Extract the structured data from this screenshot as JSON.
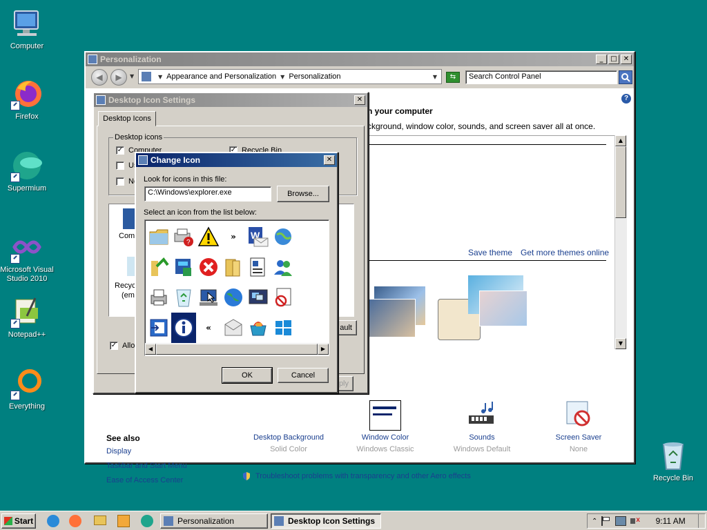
{
  "desktop": {
    "icons": [
      {
        "label": "Computer",
        "icon": "computer-icon"
      },
      {
        "label": "Firefox",
        "icon": "firefox-icon"
      },
      {
        "label": "Supermium",
        "icon": "supermium-icon"
      },
      {
        "label": "Microsoft Visual Studio 2010",
        "icon": "visual-studio-icon"
      },
      {
        "label": "Notepad++",
        "icon": "notepad-plus-plus-icon"
      },
      {
        "label": "Everything",
        "icon": "everything-icon"
      },
      {
        "label": "Recycle Bin",
        "icon": "recycle-bin-icon"
      }
    ]
  },
  "personalization": {
    "title": "Personalization",
    "breadcrumb": [
      "Appearance and Personalization",
      "Personalization"
    ],
    "search_placeholder": "Search Control Panel",
    "heading_partial": "n your computer",
    "subtitle_partial": "ckground, window color, sounds, and screen saver all at once.",
    "save_theme": "Save theme",
    "get_more_themes": "Get more themes online",
    "see_also": {
      "title": "See also",
      "links": [
        "Display",
        "Taskbar and Start Menu",
        "Ease of Access Center"
      ]
    },
    "settings": [
      {
        "label": "Desktop Background",
        "value": "Solid Color",
        "icon": "desktop-background-icon"
      },
      {
        "label": "Window Color",
        "value": "Windows Classic",
        "icon": "window-color-icon"
      },
      {
        "label": "Sounds",
        "value": "Windows Default",
        "icon": "sounds-icon"
      },
      {
        "label": "Screen Saver",
        "value": "None",
        "icon": "screen-saver-icon"
      }
    ],
    "troubleshoot": "Troubleshoot problems with transparency and other Aero effects"
  },
  "desktop_icon_settings": {
    "title": "Desktop Icon Settings",
    "tab": "Desktop Icons",
    "group_title": "Desktop icons",
    "checkboxes": [
      {
        "label": "Computer",
        "checked": true
      },
      {
        "label": "Us",
        "checked": false
      },
      {
        "label": "Ne",
        "checked": false
      },
      {
        "label": "Recycle Bin",
        "checked": true
      }
    ],
    "preview_items": [
      "Comp",
      "Recyc",
      "(emp"
    ],
    "allow_label": "Allov",
    "default_button": "ault",
    "apply_button": "ply"
  },
  "change_icon": {
    "title": "Change Icon",
    "look_label": "Look for icons in this file:",
    "path": "C:\\Windows\\explorer.exe",
    "browse": "Browse...",
    "select_label": "Select an icon from the list below:",
    "ok": "OK",
    "cancel": "Cancel"
  },
  "taskbar": {
    "start": "Start",
    "tasks": [
      {
        "label": "Personalization",
        "active": false
      },
      {
        "label": "Desktop Icon Settings",
        "active": true
      }
    ],
    "clock": "9:11 AM"
  }
}
